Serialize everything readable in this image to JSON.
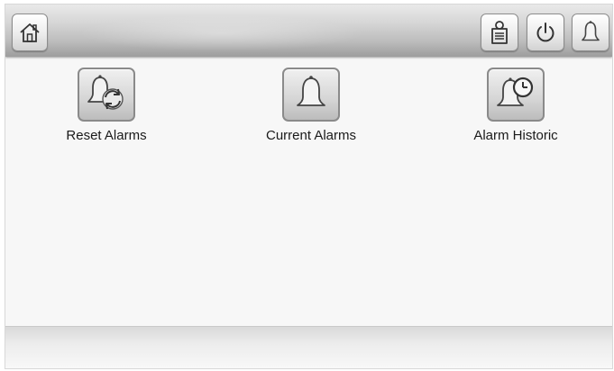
{
  "topbar": {
    "home_icon": "home-icon",
    "lock_icon": "door-hanger-lock-icon",
    "power_icon": "power-icon",
    "bell_icon": "bell-icon"
  },
  "menu": {
    "items": [
      {
        "label": "Reset Alarms",
        "icon": "bell-reset-icon"
      },
      {
        "label": "Current Alarms",
        "icon": "bell-icon"
      },
      {
        "label": "Alarm Historic",
        "icon": "bell-clock-icon"
      }
    ]
  },
  "colors": {
    "background": "#f7f7f7",
    "topbar_dark": "#9d9d9d",
    "button_border": "#8a8a8a"
  }
}
